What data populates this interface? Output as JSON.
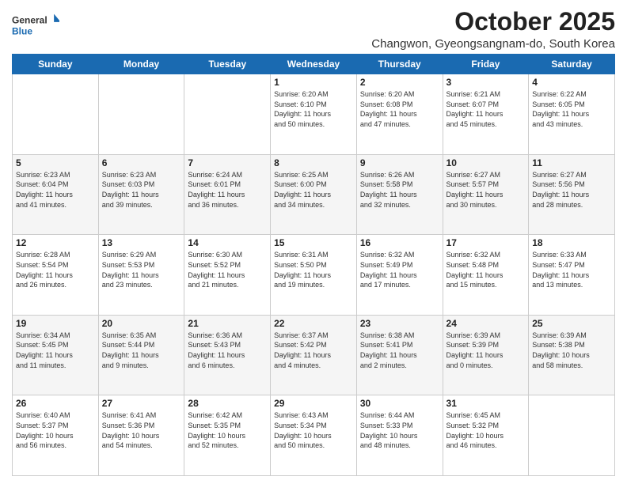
{
  "logo": {
    "line1": "General",
    "line2": "Blue"
  },
  "title": "October 2025",
  "subtitle": "Changwon, Gyeongsangnam-do, South Korea",
  "days_of_week": [
    "Sunday",
    "Monday",
    "Tuesday",
    "Wednesday",
    "Thursday",
    "Friday",
    "Saturday"
  ],
  "weeks": [
    [
      {
        "day": "",
        "info": ""
      },
      {
        "day": "",
        "info": ""
      },
      {
        "day": "",
        "info": ""
      },
      {
        "day": "1",
        "info": "Sunrise: 6:20 AM\nSunset: 6:10 PM\nDaylight: 11 hours\nand 50 minutes."
      },
      {
        "day": "2",
        "info": "Sunrise: 6:20 AM\nSunset: 6:08 PM\nDaylight: 11 hours\nand 47 minutes."
      },
      {
        "day": "3",
        "info": "Sunrise: 6:21 AM\nSunset: 6:07 PM\nDaylight: 11 hours\nand 45 minutes."
      },
      {
        "day": "4",
        "info": "Sunrise: 6:22 AM\nSunset: 6:05 PM\nDaylight: 11 hours\nand 43 minutes."
      }
    ],
    [
      {
        "day": "5",
        "info": "Sunrise: 6:23 AM\nSunset: 6:04 PM\nDaylight: 11 hours\nand 41 minutes."
      },
      {
        "day": "6",
        "info": "Sunrise: 6:23 AM\nSunset: 6:03 PM\nDaylight: 11 hours\nand 39 minutes."
      },
      {
        "day": "7",
        "info": "Sunrise: 6:24 AM\nSunset: 6:01 PM\nDaylight: 11 hours\nand 36 minutes."
      },
      {
        "day": "8",
        "info": "Sunrise: 6:25 AM\nSunset: 6:00 PM\nDaylight: 11 hours\nand 34 minutes."
      },
      {
        "day": "9",
        "info": "Sunrise: 6:26 AM\nSunset: 5:58 PM\nDaylight: 11 hours\nand 32 minutes."
      },
      {
        "day": "10",
        "info": "Sunrise: 6:27 AM\nSunset: 5:57 PM\nDaylight: 11 hours\nand 30 minutes."
      },
      {
        "day": "11",
        "info": "Sunrise: 6:27 AM\nSunset: 5:56 PM\nDaylight: 11 hours\nand 28 minutes."
      }
    ],
    [
      {
        "day": "12",
        "info": "Sunrise: 6:28 AM\nSunset: 5:54 PM\nDaylight: 11 hours\nand 26 minutes."
      },
      {
        "day": "13",
        "info": "Sunrise: 6:29 AM\nSunset: 5:53 PM\nDaylight: 11 hours\nand 23 minutes."
      },
      {
        "day": "14",
        "info": "Sunrise: 6:30 AM\nSunset: 5:52 PM\nDaylight: 11 hours\nand 21 minutes."
      },
      {
        "day": "15",
        "info": "Sunrise: 6:31 AM\nSunset: 5:50 PM\nDaylight: 11 hours\nand 19 minutes."
      },
      {
        "day": "16",
        "info": "Sunrise: 6:32 AM\nSunset: 5:49 PM\nDaylight: 11 hours\nand 17 minutes."
      },
      {
        "day": "17",
        "info": "Sunrise: 6:32 AM\nSunset: 5:48 PM\nDaylight: 11 hours\nand 15 minutes."
      },
      {
        "day": "18",
        "info": "Sunrise: 6:33 AM\nSunset: 5:47 PM\nDaylight: 11 hours\nand 13 minutes."
      }
    ],
    [
      {
        "day": "19",
        "info": "Sunrise: 6:34 AM\nSunset: 5:45 PM\nDaylight: 11 hours\nand 11 minutes."
      },
      {
        "day": "20",
        "info": "Sunrise: 6:35 AM\nSunset: 5:44 PM\nDaylight: 11 hours\nand 9 minutes."
      },
      {
        "day": "21",
        "info": "Sunrise: 6:36 AM\nSunset: 5:43 PM\nDaylight: 11 hours\nand 6 minutes."
      },
      {
        "day": "22",
        "info": "Sunrise: 6:37 AM\nSunset: 5:42 PM\nDaylight: 11 hours\nand 4 minutes."
      },
      {
        "day": "23",
        "info": "Sunrise: 6:38 AM\nSunset: 5:41 PM\nDaylight: 11 hours\nand 2 minutes."
      },
      {
        "day": "24",
        "info": "Sunrise: 6:39 AM\nSunset: 5:39 PM\nDaylight: 11 hours\nand 0 minutes."
      },
      {
        "day": "25",
        "info": "Sunrise: 6:39 AM\nSunset: 5:38 PM\nDaylight: 10 hours\nand 58 minutes."
      }
    ],
    [
      {
        "day": "26",
        "info": "Sunrise: 6:40 AM\nSunset: 5:37 PM\nDaylight: 10 hours\nand 56 minutes."
      },
      {
        "day": "27",
        "info": "Sunrise: 6:41 AM\nSunset: 5:36 PM\nDaylight: 10 hours\nand 54 minutes."
      },
      {
        "day": "28",
        "info": "Sunrise: 6:42 AM\nSunset: 5:35 PM\nDaylight: 10 hours\nand 52 minutes."
      },
      {
        "day": "29",
        "info": "Sunrise: 6:43 AM\nSunset: 5:34 PM\nDaylight: 10 hours\nand 50 minutes."
      },
      {
        "day": "30",
        "info": "Sunrise: 6:44 AM\nSunset: 5:33 PM\nDaylight: 10 hours\nand 48 minutes."
      },
      {
        "day": "31",
        "info": "Sunrise: 6:45 AM\nSunset: 5:32 PM\nDaylight: 10 hours\nand 46 minutes."
      },
      {
        "day": "",
        "info": ""
      }
    ]
  ]
}
